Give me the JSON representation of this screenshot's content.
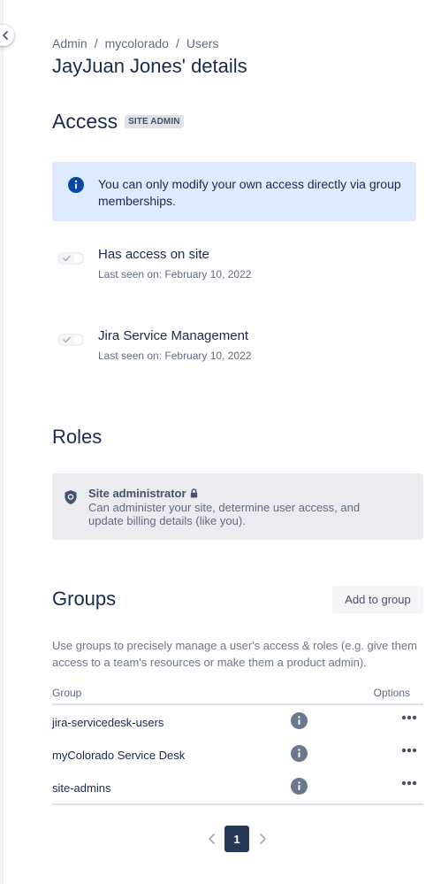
{
  "breadcrumb": {
    "items": [
      "Admin",
      "mycolorado",
      "Users"
    ],
    "separator": "/"
  },
  "page_title": "JayJuan Jones' details",
  "access": {
    "heading": "Access",
    "badge": "SITE ADMIN",
    "info_message": "You can only modify your own access directly via group memberships.",
    "items": [
      {
        "name": "Has access on site",
        "last_seen": "Last seen on: February 10, 2022",
        "enabled": true
      },
      {
        "name": "Jira Service Management",
        "last_seen": "Last seen on: February 10, 2022",
        "enabled": true
      }
    ]
  },
  "roles": {
    "heading": "Roles",
    "items": [
      {
        "title": "Site administrator",
        "description": "Can administer your site, determine user access, and update billing details (like you).",
        "icon": "shield-icon",
        "locked": true
      }
    ]
  },
  "groups": {
    "heading": "Groups",
    "add_button": "Add to group",
    "description": "Use groups to precisely manage a user's access & roles (e.g. give them access to a team's resources or make them a product admin).",
    "columns": {
      "group": "Group",
      "options": "Options"
    },
    "rows": [
      {
        "name": "jira-servicedesk-users"
      },
      {
        "name": "myColorado Service Desk"
      },
      {
        "name": "site-admins"
      }
    ]
  },
  "pagination": {
    "current_page": "1"
  },
  "colors": {
    "primary_text": "#172b4d",
    "info_background": "#deebff",
    "info_icon": "#0747a6",
    "current_page_bg": "#253858",
    "role_card_bg": "#ebecf0"
  }
}
